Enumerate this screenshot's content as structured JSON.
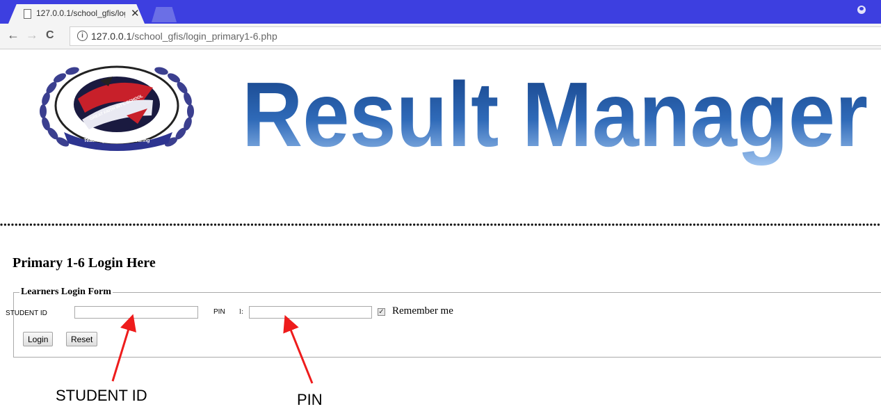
{
  "browser": {
    "tab_title": "127.0.0.1/school_gfis/log",
    "tab_close": "✕",
    "back": "←",
    "forward": "→",
    "reload": "C",
    "info": "i",
    "url_host": "127.0.0.1",
    "url_path": "/school_gfis/login_primary1-6.php"
  },
  "banner": {
    "title": "Result Manager",
    "logo_text": "GREAT FAITH INT'L SCHOOL",
    "logo_motto": "Teaching, Learning & Caring"
  },
  "page": {
    "heading": "Primary 1-6 Login Here"
  },
  "form": {
    "legend": "Learners Login Form",
    "student_id_label": "STUDENT ID",
    "student_id_value": "",
    "pin_label": "PIN",
    "pin_colon": "l:",
    "pin_value": "",
    "remember_checked": true,
    "remember_label": "Remember me",
    "login_button": "Login",
    "reset_button": "Reset"
  },
  "annotations": {
    "student_id": "STUDENT ID",
    "pin": "PIN"
  },
  "colors": {
    "tabstrip": "#3d3fe0",
    "banner_blue": "#2f5fa8",
    "arrow": "#ee1c1c"
  }
}
